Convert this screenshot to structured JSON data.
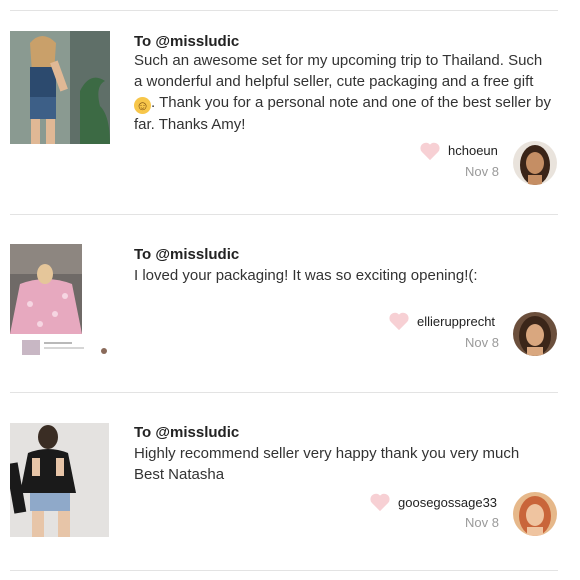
{
  "reviews": [
    {
      "recipient": "To @missludic",
      "text_before_emoji": "Such an awesome set for my upcoming trip to Thailand. Such a wonderful and helpful seller, cute packaging and a free gift ",
      "emoji": "smiling-face-emoji",
      "text_after_emoji": ". Thank you for a personal note and one of the best seller by far. Thanks Amy!",
      "username": "hchoeun",
      "date": "Nov 8"
    },
    {
      "recipient": "To @missludic",
      "text": "I loved your packaging! It was so exciting opening!(:",
      "username": "ellierupprecht",
      "date": "Nov 8"
    },
    {
      "recipient": "To @missludic",
      "text": "Highly recommend seller very happy thank you very much Best Natasha",
      "username": "goosegossage33",
      "date": "Nov 8"
    }
  ],
  "colors": {
    "heart": "#f7d0d4",
    "divider": "#e3e3e3",
    "date": "#9a9a9a"
  },
  "icons": [
    "heart-icon",
    "smiling-face-emoji"
  ]
}
